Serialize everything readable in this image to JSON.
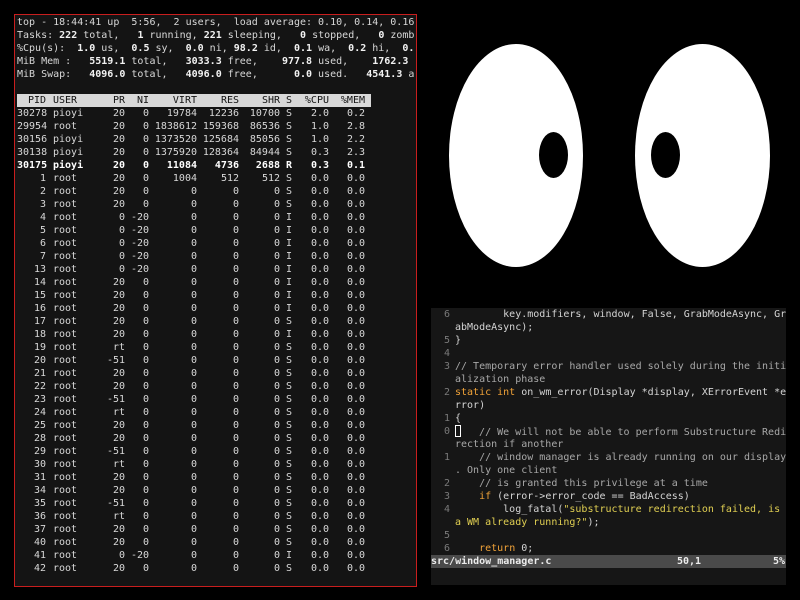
{
  "top": {
    "summary": {
      "line1": "top - 18:44:41 up  5:56,  2 users,  load average: 0.10, 0.14, 0.16",
      "tasks_label": "Tasks:",
      "tasks_total": "222",
      "tasks_total_l": " total,   ",
      "tasks_running": "1",
      "tasks_running_l": " running, ",
      "tasks_sleeping": "221",
      "tasks_sleeping_l": " sleeping,   ",
      "tasks_stopped": "0",
      "tasks_stopped_l": " stopped,   ",
      "tasks_zombie": "0",
      "tasks_zombie_l": " zomb",
      "cpu_label": "%Cpu(s):  ",
      "cpu_us": "1.0",
      "cpu_us_l": " us,  ",
      "cpu_sy": "0.5",
      "cpu_sy_l": " sy,  ",
      "cpu_ni": "0.0",
      "cpu_ni_l": " ni, ",
      "cpu_id": "98.2",
      "cpu_id_l": " id,  ",
      "cpu_wa": "0.1",
      "cpu_wa_l": " wa,  ",
      "cpu_hi": "0.2",
      "cpu_hi_l": " hi,  ",
      "cpu_si": "0.",
      "mem_label": "MiB Mem :   ",
      "mem_total": "5519.1",
      "mem_total_l": " total,   ",
      "mem_free": "3033.3",
      "mem_free_l": " free,    ",
      "mem_used": "977.8",
      "mem_used_l": " used,    ",
      "mem_buff": "1762.3",
      "mem_buff_l": " b",
      "swap_label": "MiB Swap:   ",
      "swap_total": "4096.0",
      "swap_total_l": " total,   ",
      "swap_free": "4096.0",
      "swap_free_l": " free,      ",
      "swap_used": "0.0",
      "swap_used_l": " used.   ",
      "swap_avail": "4541.3",
      "swap_avail_l": " a"
    },
    "columns": [
      "PID",
      "USER",
      "PR",
      "NI",
      "VIRT",
      "RES",
      "SHR",
      "S",
      "%CPU",
      "%MEM"
    ],
    "processes": [
      {
        "pid": "30278",
        "user": "pioyi",
        "pr": "20",
        "ni": "0",
        "virt": "19784",
        "res": "12236",
        "shr": "10700",
        "s": "S",
        "cpu": "2.0",
        "mem": "0.2"
      },
      {
        "pid": "29954",
        "user": "root",
        "pr": "20",
        "ni": "0",
        "virt": "1838612",
        "res": "159368",
        "shr": "86536",
        "s": "S",
        "cpu": "1.0",
        "mem": "2.8"
      },
      {
        "pid": "30156",
        "user": "pioyi",
        "pr": "20",
        "ni": "0",
        "virt": "1373520",
        "res": "125684",
        "shr": "85056",
        "s": "S",
        "cpu": "1.0",
        "mem": "2.2"
      },
      {
        "pid": "30138",
        "user": "pioyi",
        "pr": "20",
        "ni": "0",
        "virt": "1375920",
        "res": "128364",
        "shr": "84944",
        "s": "S",
        "cpu": "0.3",
        "mem": "2.3"
      },
      {
        "pid": "30175",
        "user": "pioyi",
        "pr": "20",
        "ni": "0",
        "virt": "11084",
        "res": "4736",
        "shr": "2688",
        "s": "R",
        "cpu": "0.3",
        "mem": "0.1",
        "bold": true
      },
      {
        "pid": "1",
        "user": "root",
        "pr": "20",
        "ni": "0",
        "virt": "1004",
        "res": "512",
        "shr": "512",
        "s": "S",
        "cpu": "0.0",
        "mem": "0.0"
      },
      {
        "pid": "2",
        "user": "root",
        "pr": "20",
        "ni": "0",
        "virt": "0",
        "res": "0",
        "shr": "0",
        "s": "S",
        "cpu": "0.0",
        "mem": "0.0"
      },
      {
        "pid": "3",
        "user": "root",
        "pr": "20",
        "ni": "0",
        "virt": "0",
        "res": "0",
        "shr": "0",
        "s": "S",
        "cpu": "0.0",
        "mem": "0.0"
      },
      {
        "pid": "4",
        "user": "root",
        "pr": "0",
        "ni": "-20",
        "virt": "0",
        "res": "0",
        "shr": "0",
        "s": "I",
        "cpu": "0.0",
        "mem": "0.0"
      },
      {
        "pid": "5",
        "user": "root",
        "pr": "0",
        "ni": "-20",
        "virt": "0",
        "res": "0",
        "shr": "0",
        "s": "I",
        "cpu": "0.0",
        "mem": "0.0"
      },
      {
        "pid": "6",
        "user": "root",
        "pr": "0",
        "ni": "-20",
        "virt": "0",
        "res": "0",
        "shr": "0",
        "s": "I",
        "cpu": "0.0",
        "mem": "0.0"
      },
      {
        "pid": "7",
        "user": "root",
        "pr": "0",
        "ni": "-20",
        "virt": "0",
        "res": "0",
        "shr": "0",
        "s": "I",
        "cpu": "0.0",
        "mem": "0.0"
      },
      {
        "pid": "13",
        "user": "root",
        "pr": "0",
        "ni": "-20",
        "virt": "0",
        "res": "0",
        "shr": "0",
        "s": "I",
        "cpu": "0.0",
        "mem": "0.0"
      },
      {
        "pid": "14",
        "user": "root",
        "pr": "20",
        "ni": "0",
        "virt": "0",
        "res": "0",
        "shr": "0",
        "s": "I",
        "cpu": "0.0",
        "mem": "0.0"
      },
      {
        "pid": "15",
        "user": "root",
        "pr": "20",
        "ni": "0",
        "virt": "0",
        "res": "0",
        "shr": "0",
        "s": "I",
        "cpu": "0.0",
        "mem": "0.0"
      },
      {
        "pid": "16",
        "user": "root",
        "pr": "20",
        "ni": "0",
        "virt": "0",
        "res": "0",
        "shr": "0",
        "s": "I",
        "cpu": "0.0",
        "mem": "0.0"
      },
      {
        "pid": "17",
        "user": "root",
        "pr": "20",
        "ni": "0",
        "virt": "0",
        "res": "0",
        "shr": "0",
        "s": "S",
        "cpu": "0.0",
        "mem": "0.0"
      },
      {
        "pid": "18",
        "user": "root",
        "pr": "20",
        "ni": "0",
        "virt": "0",
        "res": "0",
        "shr": "0",
        "s": "I",
        "cpu": "0.0",
        "mem": "0.0"
      },
      {
        "pid": "19",
        "user": "root",
        "pr": "rt",
        "ni": "0",
        "virt": "0",
        "res": "0",
        "shr": "0",
        "s": "S",
        "cpu": "0.0",
        "mem": "0.0"
      },
      {
        "pid": "20",
        "user": "root",
        "pr": "-51",
        "ni": "0",
        "virt": "0",
        "res": "0",
        "shr": "0",
        "s": "S",
        "cpu": "0.0",
        "mem": "0.0"
      },
      {
        "pid": "21",
        "user": "root",
        "pr": "20",
        "ni": "0",
        "virt": "0",
        "res": "0",
        "shr": "0",
        "s": "S",
        "cpu": "0.0",
        "mem": "0.0"
      },
      {
        "pid": "22",
        "user": "root",
        "pr": "20",
        "ni": "0",
        "virt": "0",
        "res": "0",
        "shr": "0",
        "s": "S",
        "cpu": "0.0",
        "mem": "0.0"
      },
      {
        "pid": "23",
        "user": "root",
        "pr": "-51",
        "ni": "0",
        "virt": "0",
        "res": "0",
        "shr": "0",
        "s": "S",
        "cpu": "0.0",
        "mem": "0.0"
      },
      {
        "pid": "24",
        "user": "root",
        "pr": "rt",
        "ni": "0",
        "virt": "0",
        "res": "0",
        "shr": "0",
        "s": "S",
        "cpu": "0.0",
        "mem": "0.0"
      },
      {
        "pid": "25",
        "user": "root",
        "pr": "20",
        "ni": "0",
        "virt": "0",
        "res": "0",
        "shr": "0",
        "s": "S",
        "cpu": "0.0",
        "mem": "0.0"
      },
      {
        "pid": "28",
        "user": "root",
        "pr": "20",
        "ni": "0",
        "virt": "0",
        "res": "0",
        "shr": "0",
        "s": "S",
        "cpu": "0.0",
        "mem": "0.0"
      },
      {
        "pid": "29",
        "user": "root",
        "pr": "-51",
        "ni": "0",
        "virt": "0",
        "res": "0",
        "shr": "0",
        "s": "S",
        "cpu": "0.0",
        "mem": "0.0"
      },
      {
        "pid": "30",
        "user": "root",
        "pr": "rt",
        "ni": "0",
        "virt": "0",
        "res": "0",
        "shr": "0",
        "s": "S",
        "cpu": "0.0",
        "mem": "0.0"
      },
      {
        "pid": "31",
        "user": "root",
        "pr": "20",
        "ni": "0",
        "virt": "0",
        "res": "0",
        "shr": "0",
        "s": "S",
        "cpu": "0.0",
        "mem": "0.0"
      },
      {
        "pid": "34",
        "user": "root",
        "pr": "20",
        "ni": "0",
        "virt": "0",
        "res": "0",
        "shr": "0",
        "s": "S",
        "cpu": "0.0",
        "mem": "0.0"
      },
      {
        "pid": "35",
        "user": "root",
        "pr": "-51",
        "ni": "0",
        "virt": "0",
        "res": "0",
        "shr": "0",
        "s": "S",
        "cpu": "0.0",
        "mem": "0.0"
      },
      {
        "pid": "36",
        "user": "root",
        "pr": "rt",
        "ni": "0",
        "virt": "0",
        "res": "0",
        "shr": "0",
        "s": "S",
        "cpu": "0.0",
        "mem": "0.0"
      },
      {
        "pid": "37",
        "user": "root",
        "pr": "20",
        "ni": "0",
        "virt": "0",
        "res": "0",
        "shr": "0",
        "s": "S",
        "cpu": "0.0",
        "mem": "0.0"
      },
      {
        "pid": "40",
        "user": "root",
        "pr": "20",
        "ni": "0",
        "virt": "0",
        "res": "0",
        "shr": "0",
        "s": "S",
        "cpu": "0.0",
        "mem": "0.0"
      },
      {
        "pid": "41",
        "user": "root",
        "pr": "0",
        "ni": "-20",
        "virt": "0",
        "res": "0",
        "shr": "0",
        "s": "I",
        "cpu": "0.0",
        "mem": "0.0"
      },
      {
        "pid": "42",
        "user": "root",
        "pr": "20",
        "ni": "0",
        "virt": "0",
        "res": "0",
        "shr": "0",
        "s": "S",
        "cpu": "0.0",
        "mem": "0.0"
      }
    ]
  },
  "vim": {
    "lines": [
      {
        "num": "6",
        "parts": [
          [
            "t",
            "        key.modifiers, window, False, GrabModeAsync, Gr"
          ]
        ]
      },
      {
        "num": "",
        "parts": [
          [
            "t",
            "abModeAsync);"
          ]
        ]
      },
      {
        "num": "5",
        "parts": [
          [
            "t",
            "}"
          ]
        ]
      },
      {
        "num": "4",
        "parts": []
      },
      {
        "num": "3",
        "parts": [
          [
            "cm",
            "// Temporary error handler used solely during the initi"
          ]
        ]
      },
      {
        "num": "",
        "parts": [
          [
            "cm",
            "alization phase"
          ]
        ]
      },
      {
        "num": "2",
        "parts": [
          [
            "kw",
            "static int"
          ],
          [
            "t",
            " on_wm_error(Display *display, XErrorEvent *e"
          ]
        ]
      },
      {
        "num": "",
        "parts": [
          [
            "t",
            "rror)"
          ]
        ]
      },
      {
        "num": "1",
        "parts": [
          [
            "t",
            "{"
          ]
        ]
      },
      {
        "num": "0",
        "parts": [
          [
            "cursor",
            ""
          ],
          [
            "cm",
            "   // We will not be able to perform Substructure Redi"
          ]
        ]
      },
      {
        "num": "",
        "parts": [
          [
            "cm",
            "rection if another"
          ]
        ]
      },
      {
        "num": "1",
        "parts": [
          [
            "cm",
            "    // window manager is already running on our display"
          ]
        ]
      },
      {
        "num": "",
        "parts": [
          [
            "cm",
            ". Only one client"
          ]
        ]
      },
      {
        "num": "2",
        "parts": [
          [
            "cm",
            "    // is granted this privilege at a time"
          ]
        ]
      },
      {
        "num": "3",
        "parts": [
          [
            "t",
            "    "
          ],
          [
            "kw",
            "if"
          ],
          [
            "t",
            " (error->error_code == BadAccess)"
          ]
        ]
      },
      {
        "num": "4",
        "parts": [
          [
            "t",
            "        log_fatal("
          ],
          [
            "str",
            "\"substructure redirection failed, is"
          ]
        ]
      },
      {
        "num": "",
        "parts": [
          [
            "str",
            "a WM already running?\""
          ],
          [
            "t",
            ");"
          ]
        ]
      },
      {
        "num": "5",
        "parts": []
      },
      {
        "num": "6",
        "parts": [
          [
            "t",
            "    "
          ],
          [
            "kw",
            "return"
          ],
          [
            "t",
            " 0;"
          ]
        ]
      }
    ],
    "status": {
      "file": "src/window_manager.c",
      "position": "50,1",
      "percent": "5%"
    }
  },
  "colors": {
    "border": "#c81e1e",
    "keyword": "#f0a238",
    "string": "#e0cf52"
  },
  "icons": [
    "xeyes-left-eye",
    "xeyes-right-eye"
  ]
}
